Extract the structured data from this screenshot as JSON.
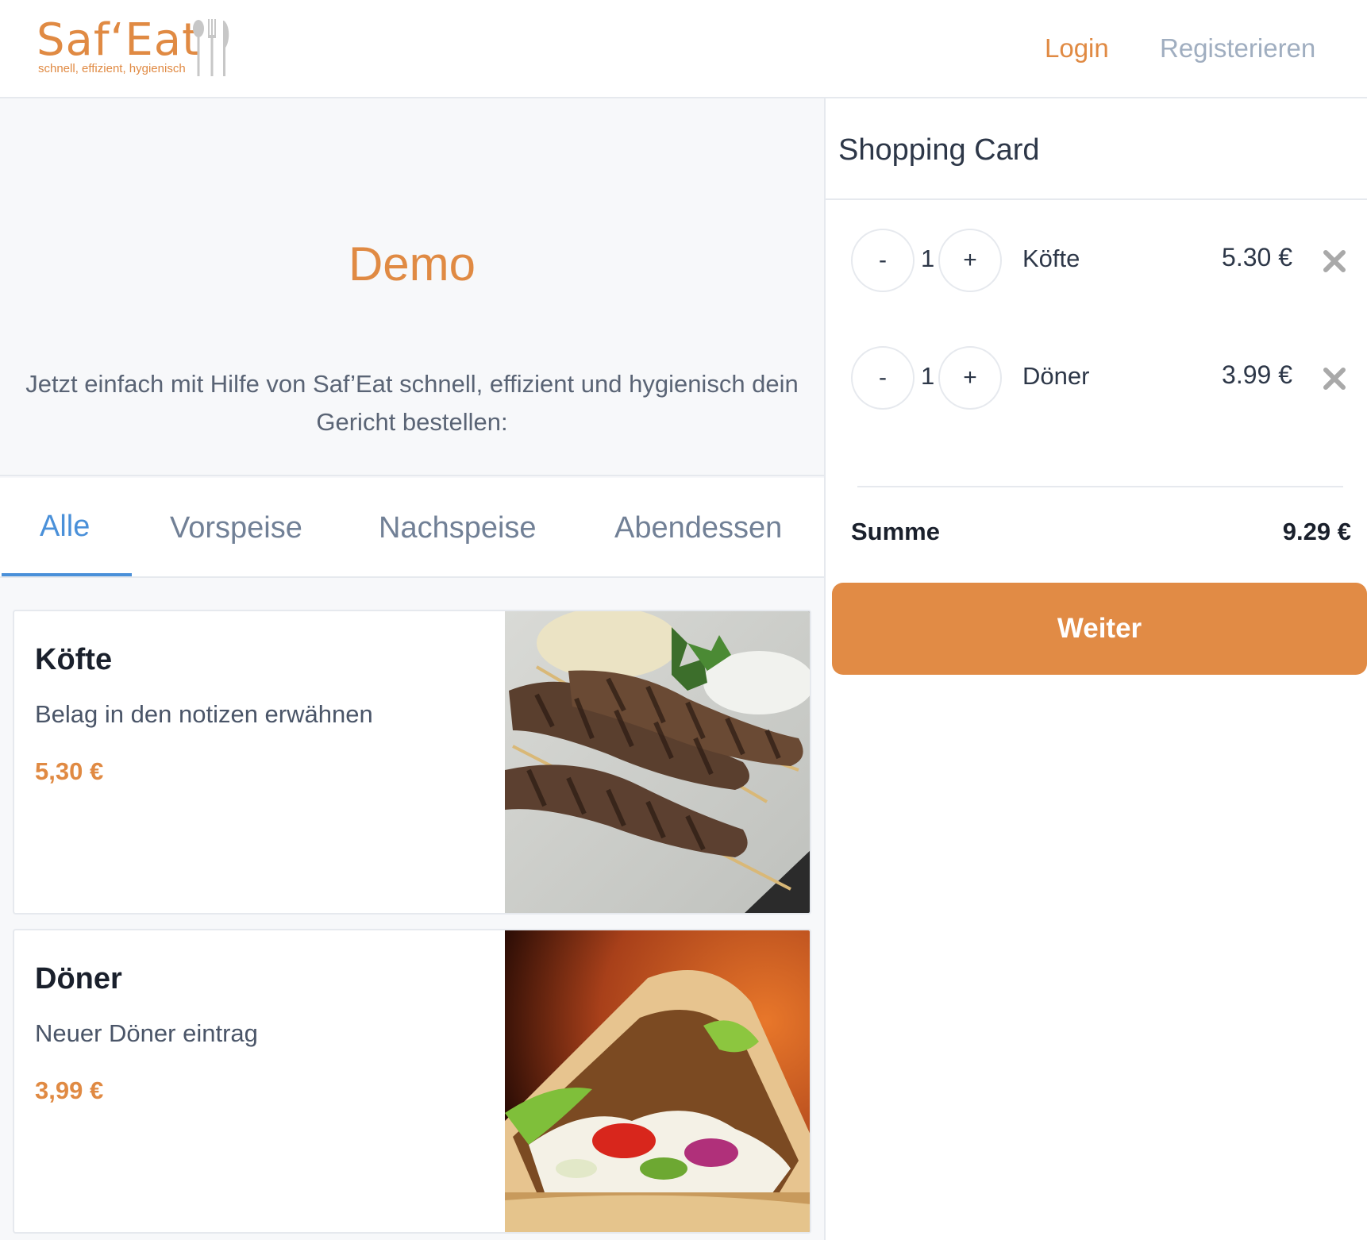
{
  "header": {
    "logo_text": "Saf‘Eat",
    "logo_tagline": "schnell, effizient, hygienisch",
    "login_label": "Login",
    "register_label": "Registerieren"
  },
  "hero": {
    "title": "Demo",
    "text": "Jetzt einfach mit Hilfe von Saf’Eat schnell, effizient und hygienisch dein Gericht bestellen:"
  },
  "tabs": [
    {
      "label": "Alle",
      "active": true
    },
    {
      "label": "Vorspeise",
      "active": false
    },
    {
      "label": "Nachspeise",
      "active": false
    },
    {
      "label": "Abendessen",
      "active": false
    }
  ],
  "menu": [
    {
      "name": "Köfte",
      "description": "Belag in den notizen erwähnen",
      "price": "5,30 €"
    },
    {
      "name": "Döner",
      "description": "Neuer Döner eintrag",
      "price": "3,99 €"
    }
  ],
  "cart": {
    "title": "Shopping Card",
    "items": [
      {
        "minus": "-",
        "qty": "1",
        "plus": "+",
        "name": "Köfte",
        "price": "5.30 €"
      },
      {
        "minus": "-",
        "qty": "1",
        "plus": "+",
        "name": "Döner",
        "price": "3.99 €"
      }
    ],
    "sum_label": "Summe",
    "sum_value": "9.29 €",
    "continue_label": "Weiter"
  },
  "colors": {
    "accent": "#e08a43",
    "active_tab": "#4a90d9",
    "muted": "#a0aec0"
  }
}
